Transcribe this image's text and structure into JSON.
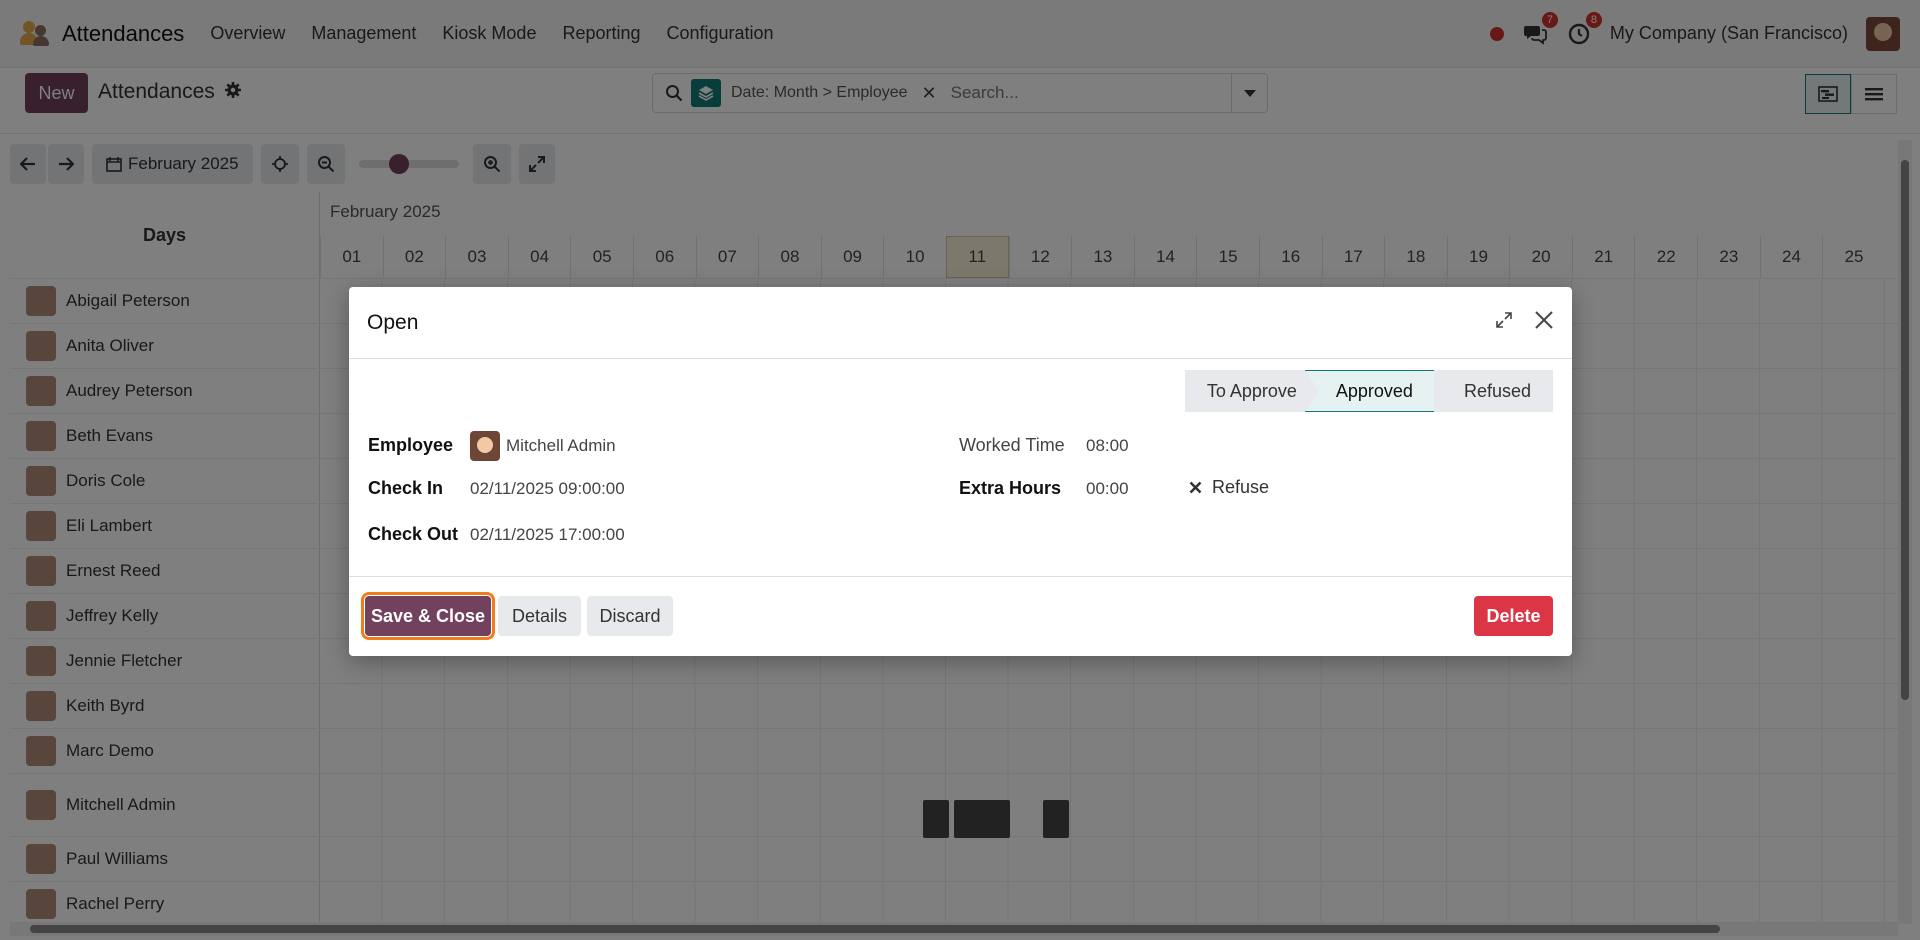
{
  "app": {
    "name": "Attendances",
    "menu": [
      "Overview",
      "Management",
      "Kiosk Mode",
      "Reporting",
      "Configuration"
    ],
    "messages_count": "7",
    "activities_count": "8",
    "company": "My Company (San Francisco)"
  },
  "control_panel": {
    "new_label": "New",
    "title": "Attendances",
    "search_facet": "Date: Month > Employee",
    "search_placeholder": "Search..."
  },
  "gantt": {
    "period_label": "February 2025",
    "month_label": "February 2025",
    "rows_header": "Days",
    "days": [
      "01",
      "02",
      "03",
      "04",
      "05",
      "06",
      "07",
      "08",
      "09",
      "10",
      "11",
      "12",
      "13",
      "14",
      "15",
      "16",
      "17",
      "18",
      "19",
      "20",
      "21",
      "22",
      "23",
      "24",
      "25"
    ],
    "today": "11",
    "employees": [
      "Abigail Peterson",
      "Anita Oliver",
      "Audrey Peterson",
      "Beth Evans",
      "Doris Cole",
      "Eli Lambert",
      "Ernest Reed",
      "Jeffrey Kelly",
      "Jennie Fletcher",
      "Keith Byrd",
      "Marc Demo",
      "Mitchell Admin",
      "Paul Williams",
      "Rachel Perry"
    ]
  },
  "modal": {
    "title": "Open",
    "stages": [
      "To Approve",
      "Approved",
      "Refused"
    ],
    "active_stage": "Approved",
    "employee_label": "Employee",
    "employee_value": "Mitchell Admin",
    "check_in_label": "Check In",
    "check_in_value": "02/11/2025 09:00:00",
    "check_out_label": "Check Out",
    "check_out_value": "02/11/2025 17:00:00",
    "worked_time_label": "Worked Time",
    "worked_time_value": "08:00",
    "extra_hours_label": "Extra Hours",
    "extra_hours_value": "00:00",
    "refuse_label": "Refuse",
    "buttons": {
      "save_close": "Save & Close",
      "details": "Details",
      "discard": "Discard",
      "delete": "Delete"
    }
  }
}
